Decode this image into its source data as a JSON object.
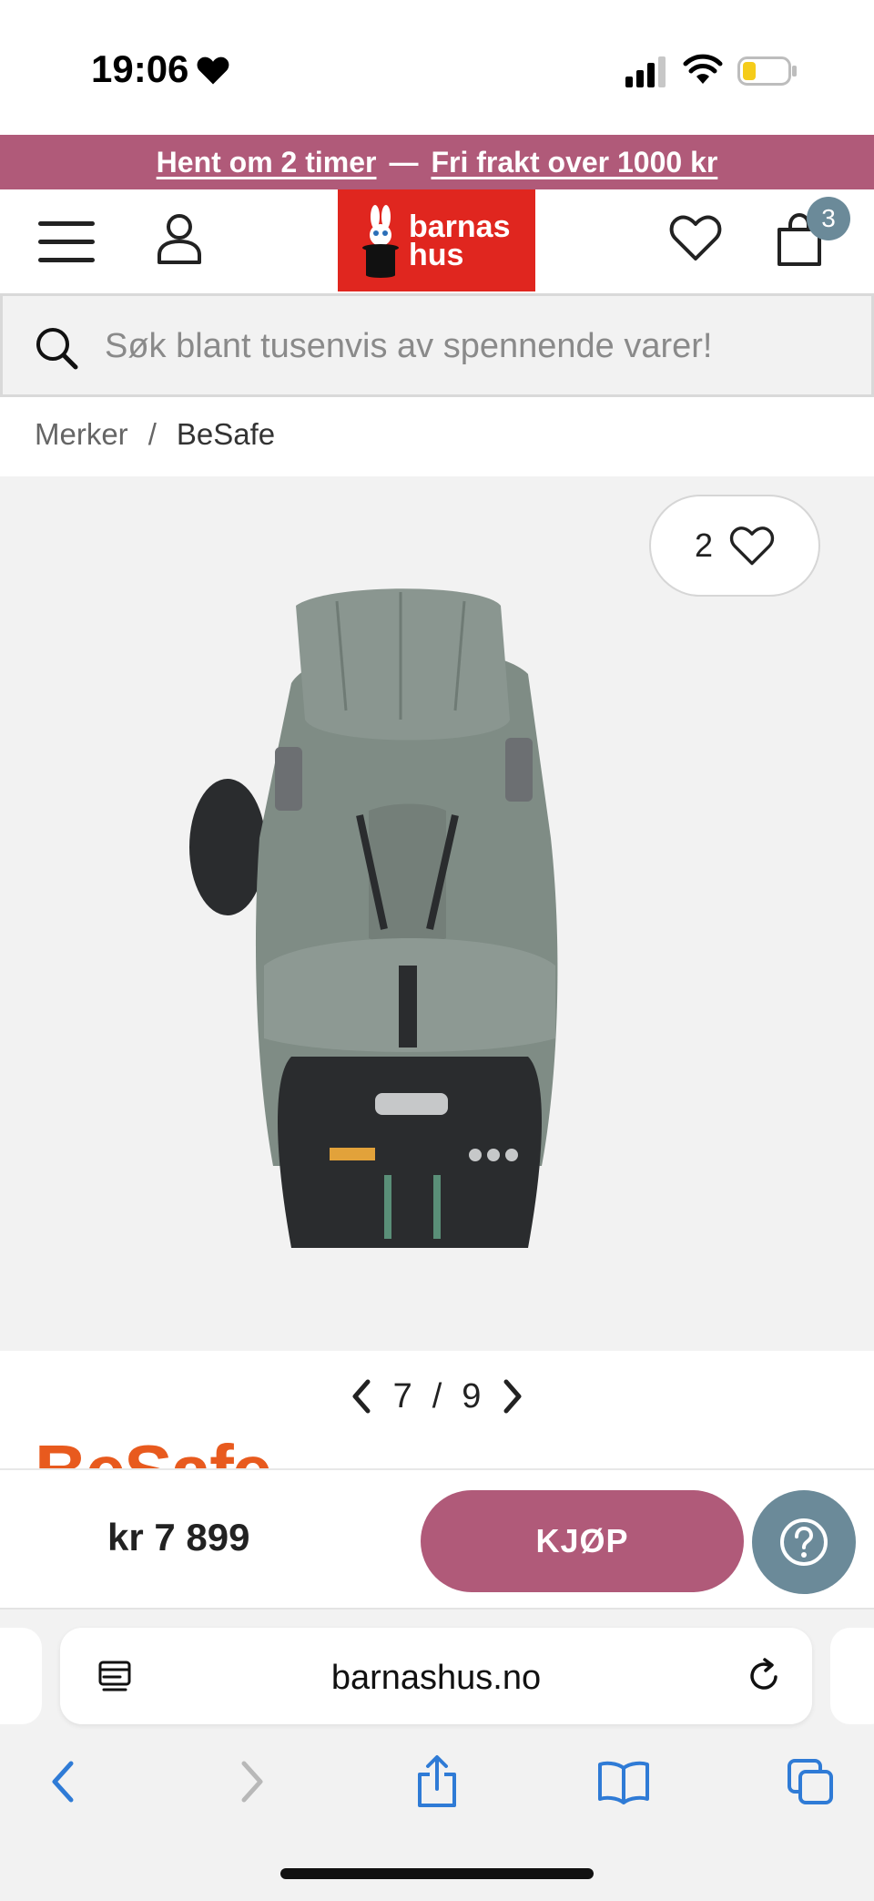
{
  "status_bar": {
    "time": "19:06"
  },
  "promo": {
    "part1": "Hent om 2 timer",
    "separator": "—",
    "part2": "Fri frakt over 1000 kr"
  },
  "header": {
    "logo_line1": "barnas",
    "logo_line2": "hus",
    "cart_count": "3"
  },
  "search": {
    "placeholder": "Søk blant tusenvis av spennende varer!"
  },
  "breadcrumb": {
    "items": [
      "Merker",
      "BeSafe"
    ],
    "separator": "/"
  },
  "gallery": {
    "favorite_count": "2",
    "current": "7",
    "separator": "/",
    "total": "9"
  },
  "brand_logo_text": "BeSafe",
  "buy_bar": {
    "price": "kr 7 899",
    "buy_label": "KJØP"
  },
  "browser": {
    "url": "barnashus.no"
  },
  "colors": {
    "accent": "#b05a79",
    "secondary": "#6b8a99",
    "logo_red": "#e0261f",
    "brand_orange": "#e85a1e",
    "ios_blue": "#2f7bd6"
  }
}
